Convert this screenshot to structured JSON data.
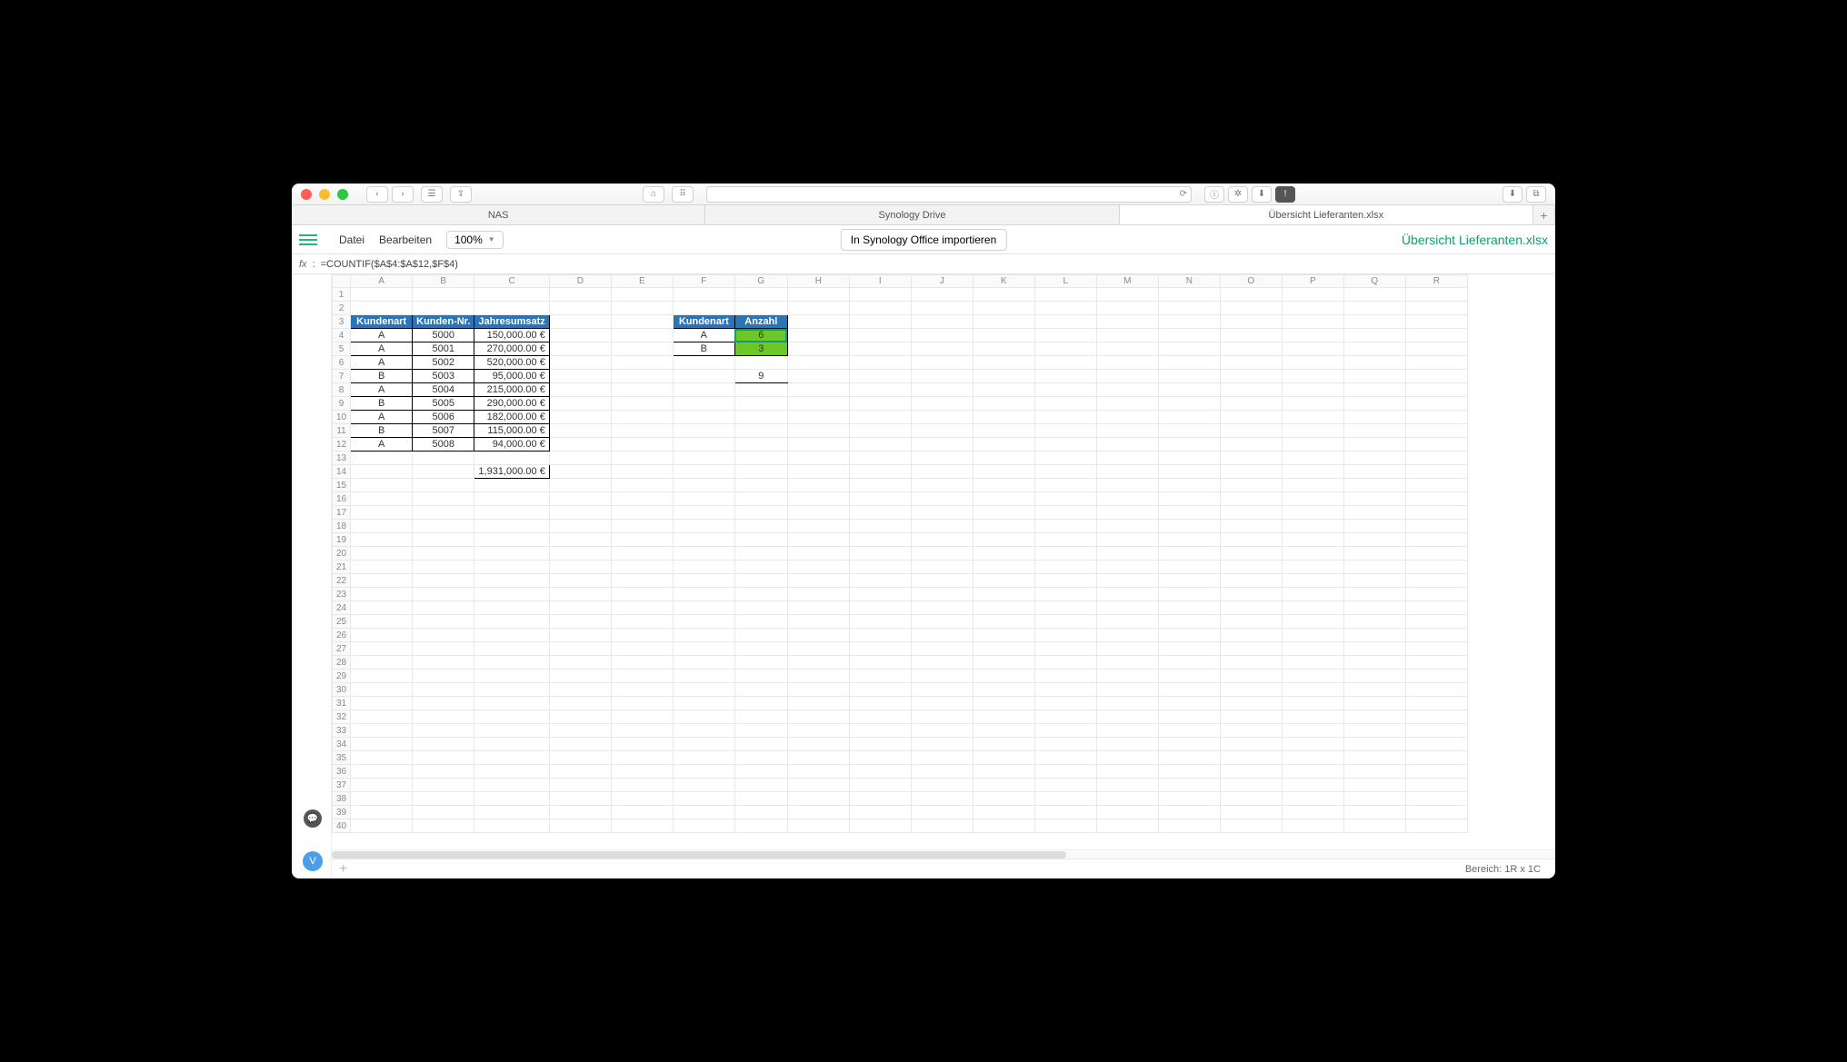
{
  "browser": {
    "tabs": [
      "NAS",
      "Synology Drive",
      "Übersicht Lieferanten.xlsx"
    ],
    "active_tab": 2
  },
  "app": {
    "menu": {
      "file": "Datei",
      "edit": "Bearbeiten"
    },
    "zoom": "100%",
    "import_button": "In Synology Office importieren",
    "doc_title": "Übersicht Lieferanten.xlsx"
  },
  "formula_bar": {
    "label": "fx",
    "formula": "=COUNTIF($A$4:$A$12,$F$4)"
  },
  "columns": [
    "A",
    "B",
    "C",
    "D",
    "E",
    "F",
    "G",
    "H",
    "I",
    "J",
    "K",
    "L",
    "M",
    "N",
    "O",
    "P",
    "Q",
    "R"
  ],
  "rows_count": 40,
  "active_cell": {
    "row": 4,
    "col": "G"
  },
  "table1": {
    "header_row": 3,
    "headers": [
      "Kundenart",
      "Kunden-Nr.",
      "Jahresumsatz"
    ],
    "start_col": "A",
    "rows": [
      {
        "row": 4,
        "a": "A",
        "b": "5000",
        "c": "150,000.00 €"
      },
      {
        "row": 5,
        "a": "A",
        "b": "5001",
        "c": "270,000.00 €"
      },
      {
        "row": 6,
        "a": "A",
        "b": "5002",
        "c": "520,000.00 €"
      },
      {
        "row": 7,
        "a": "B",
        "b": "5003",
        "c": "95,000.00 €"
      },
      {
        "row": 8,
        "a": "A",
        "b": "5004",
        "c": "215,000.00 €"
      },
      {
        "row": 9,
        "a": "B",
        "b": "5005",
        "c": "290,000.00 €"
      },
      {
        "row": 10,
        "a": "A",
        "b": "5006",
        "c": "182,000.00 €"
      },
      {
        "row": 11,
        "a": "B",
        "b": "5007",
        "c": "115,000.00 €"
      },
      {
        "row": 12,
        "a": "A",
        "b": "5008",
        "c": "94,000.00 €"
      }
    ],
    "total_row": 14,
    "total": "1,931,000.00 €"
  },
  "table2": {
    "header_row": 3,
    "headers": [
      "Kundenart",
      "Anzahl"
    ],
    "start_col": "F",
    "rows": [
      {
        "row": 4,
        "f": "A",
        "g": "6"
      },
      {
        "row": 5,
        "f": "B",
        "g": "3"
      }
    ],
    "total_row": 7,
    "total": "9"
  },
  "status_bar": "Bereich: 1R x 1C",
  "avatar_letter": "V"
}
